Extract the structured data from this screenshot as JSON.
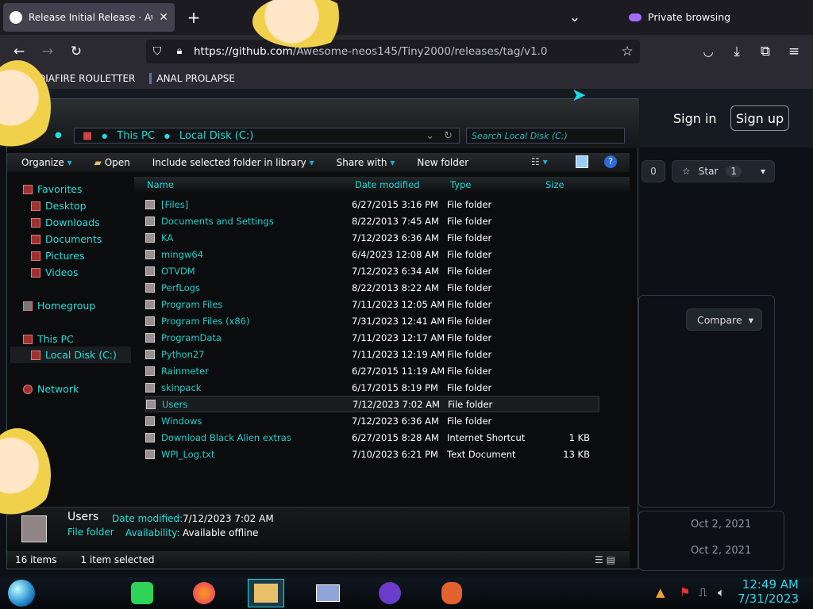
{
  "browser": {
    "tab_title": "Release Initial Release · Awesome",
    "new_tab": "+",
    "private_label": "Private browsing",
    "url_host": "https://github.com",
    "url_path": "/Awesome-neos145/Tiny2000/releases/tag/v1.0",
    "bookmarks": [
      "DIAFIRE ROULETTER",
      "ANAL PROLAPSE"
    ]
  },
  "github": {
    "sign_in": "Sign in",
    "sign_up": "Sign up",
    "watch_count": "0",
    "star_label": "Star",
    "star_count": "1",
    "compare_label": "Compare",
    "dates": [
      "Oct 2, 2021",
      "Oct 2, 2021"
    ]
  },
  "explorer": {
    "address": [
      "This PC",
      "Local Disk (C:)"
    ],
    "search_placeholder": "Search Local Disk (C:)",
    "commands": [
      "Organize",
      "Open",
      "Include selected folder in library",
      "Share with",
      "New folder"
    ],
    "nav": {
      "favorites": "Favorites",
      "fav_items": [
        "Desktop",
        "Downloads",
        "Documents",
        "Pictures",
        "Videos"
      ],
      "homegroup": "Homegroup",
      "thispc": "This PC",
      "localdisk": "Local Disk (C:)",
      "network": "Network"
    },
    "columns": {
      "name": "Name",
      "date": "Date modified",
      "type": "Type",
      "size": "Size"
    },
    "rows": [
      [
        "[Files]",
        "6/27/2015 3:16 PM",
        "File folder",
        ""
      ],
      [
        "Documents and Settings",
        "8/22/2013 7:45 AM",
        "File folder",
        ""
      ],
      [
        "KA",
        "7/12/2023 6:36 AM",
        "File folder",
        ""
      ],
      [
        "mingw64",
        "6/4/2023 12:08 AM",
        "File folder",
        ""
      ],
      [
        "OTVDM",
        "7/12/2023 6:34 AM",
        "File folder",
        ""
      ],
      [
        "PerfLogs",
        "8/22/2013 8:22 AM",
        "File folder",
        ""
      ],
      [
        "Program Files",
        "7/11/2023 12:05 AM",
        "File folder",
        ""
      ],
      [
        "Program Files (x86)",
        "7/31/2023 12:41 AM",
        "File folder",
        ""
      ],
      [
        "ProgramData",
        "7/11/2023 12:17 AM",
        "File folder",
        ""
      ],
      [
        "Python27",
        "7/11/2023 12:19 AM",
        "File folder",
        ""
      ],
      [
        "Rainmeter",
        "6/27/2015 11:19 AM",
        "File folder",
        ""
      ],
      [
        "skinpack",
        "6/17/2015 8:19 PM",
        "File folder",
        ""
      ],
      [
        "Users",
        "7/12/2023 7:02 AM",
        "File folder",
        ""
      ],
      [
        "Windows",
        "7/12/2023 6:36 AM",
        "File folder",
        ""
      ],
      [
        "Download Black Alien extras",
        "6/27/2015 8:28 AM",
        "Internet Shortcut",
        "1 KB"
      ],
      [
        "WPI_Log.txt",
        "7/10/2023 6:21 PM",
        "Text Document",
        "13 KB"
      ]
    ],
    "selected_index": 12,
    "details": {
      "name": "Users",
      "kind": "File folder",
      "date_label": "Date modified:",
      "date_value": "7/12/2023 7:02 AM",
      "avail_label": "Availability:",
      "avail_value": "Available offline"
    },
    "status": {
      "count": "16 items",
      "selected": "1 item selected"
    }
  },
  "taskbar": {
    "time": "12:49 AM",
    "date": "7/31/2023"
  },
  "colors": {
    "accent": "#22e0e0",
    "selected_row": "#1a1d1f"
  }
}
